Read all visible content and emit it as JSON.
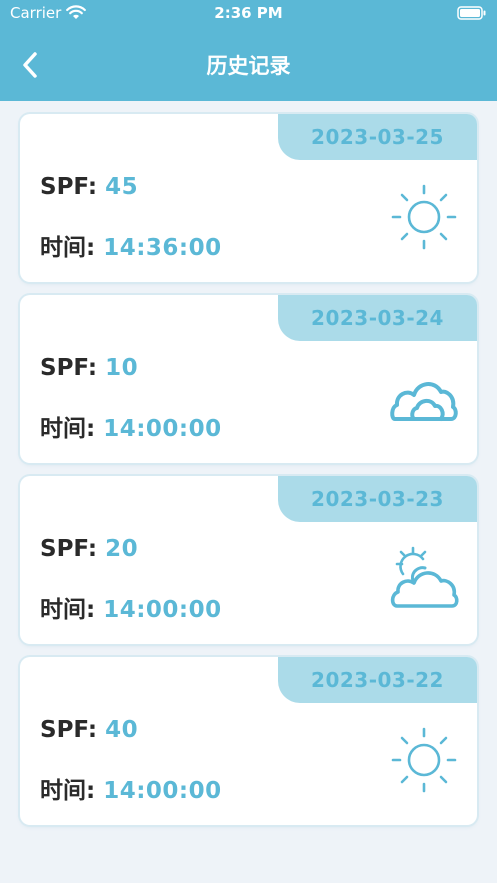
{
  "status_bar": {
    "carrier": "Carrier",
    "time": "2:36 PM"
  },
  "header": {
    "title": "历史记录",
    "back_icon": "chevron-left-icon"
  },
  "records": [
    {
      "date": "2023-03-25",
      "spf_label": "SPF:",
      "spf": "45",
      "time_label": "时间:",
      "time": "14:36:00",
      "weather": "sun-icon"
    },
    {
      "date": "2023-03-24",
      "spf_label": "SPF:",
      "spf": "10",
      "time_label": "时间:",
      "time": "14:00:00",
      "weather": "cloud-icon"
    },
    {
      "date": "2023-03-23",
      "spf_label": "SPF:",
      "spf": "20",
      "time_label": "时间:",
      "time": "14:00:00",
      "weather": "partly-cloudy-icon"
    },
    {
      "date": "2023-03-22",
      "spf_label": "SPF:",
      "spf": "40",
      "time_label": "时间:",
      "time": "14:00:00",
      "weather": "sun-icon"
    }
  ],
  "colors": {
    "accent": "#5bb8d6",
    "tab": "#abdbe9",
    "background": "#eef3f8"
  }
}
